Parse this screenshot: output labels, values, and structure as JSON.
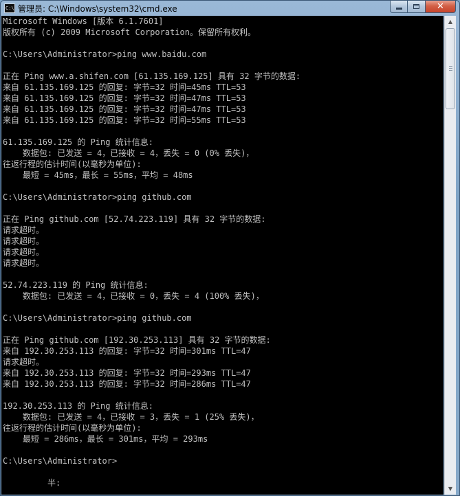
{
  "window": {
    "title": "管理员: C:\\Windows\\system32\\cmd.exe",
    "icon": "cmd-icon",
    "icon_text": "C:\\"
  },
  "controls": {
    "minimize": "minimize-icon",
    "maximize": "maximize-icon",
    "close_label": "✕"
  },
  "console": {
    "lines": [
      "Microsoft Windows [版本 6.1.7601]",
      "版权所有 (c) 2009 Microsoft Corporation。保留所有权利。",
      "",
      "C:\\Users\\Administrator>ping www.baidu.com",
      "",
      "正在 Ping www.a.shifen.com [61.135.169.125] 具有 32 字节的数据:",
      "来自 61.135.169.125 的回复: 字节=32 时间=45ms TTL=53",
      "来自 61.135.169.125 的回复: 字节=32 时间=47ms TTL=53",
      "来自 61.135.169.125 的回复: 字节=32 时间=47ms TTL=53",
      "来自 61.135.169.125 的回复: 字节=32 时间=55ms TTL=53",
      "",
      "61.135.169.125 的 Ping 统计信息:",
      "    数据包: 已发送 = 4，已接收 = 4，丢失 = 0 (0% 丢失)，",
      "往返行程的估计时间(以毫秒为单位):",
      "    最短 = 45ms，最长 = 55ms，平均 = 48ms",
      "",
      "C:\\Users\\Administrator>ping github.com",
      "",
      "正在 Ping github.com [52.74.223.119] 具有 32 字节的数据:",
      "请求超时。",
      "请求超时。",
      "请求超时。",
      "请求超时。",
      "",
      "52.74.223.119 的 Ping 统计信息:",
      "    数据包: 已发送 = 4，已接收 = 0，丢失 = 4 (100% 丢失)，",
      "",
      "C:\\Users\\Administrator>ping github.com",
      "",
      "正在 Ping github.com [192.30.253.113] 具有 32 字节的数据:",
      "来自 192.30.253.113 的回复: 字节=32 时间=301ms TTL=47",
      "请求超时。",
      "来自 192.30.253.113 的回复: 字节=32 时间=293ms TTL=47",
      "来自 192.30.253.113 的回复: 字节=32 时间=286ms TTL=47",
      "",
      "192.30.253.113 的 Ping 统计信息:",
      "    数据包: 已发送 = 4，已接收 = 3，丢失 = 1 (25% 丢失)，",
      "往返行程的估计时间(以毫秒为单位):",
      "    最短 = 286ms，最长 = 301ms，平均 = 293ms",
      "",
      "C:\\Users\\Administrator>",
      "",
      "         半:"
    ]
  },
  "colors": {
    "console_bg": "#000000",
    "console_fg": "#c0c0c0"
  }
}
